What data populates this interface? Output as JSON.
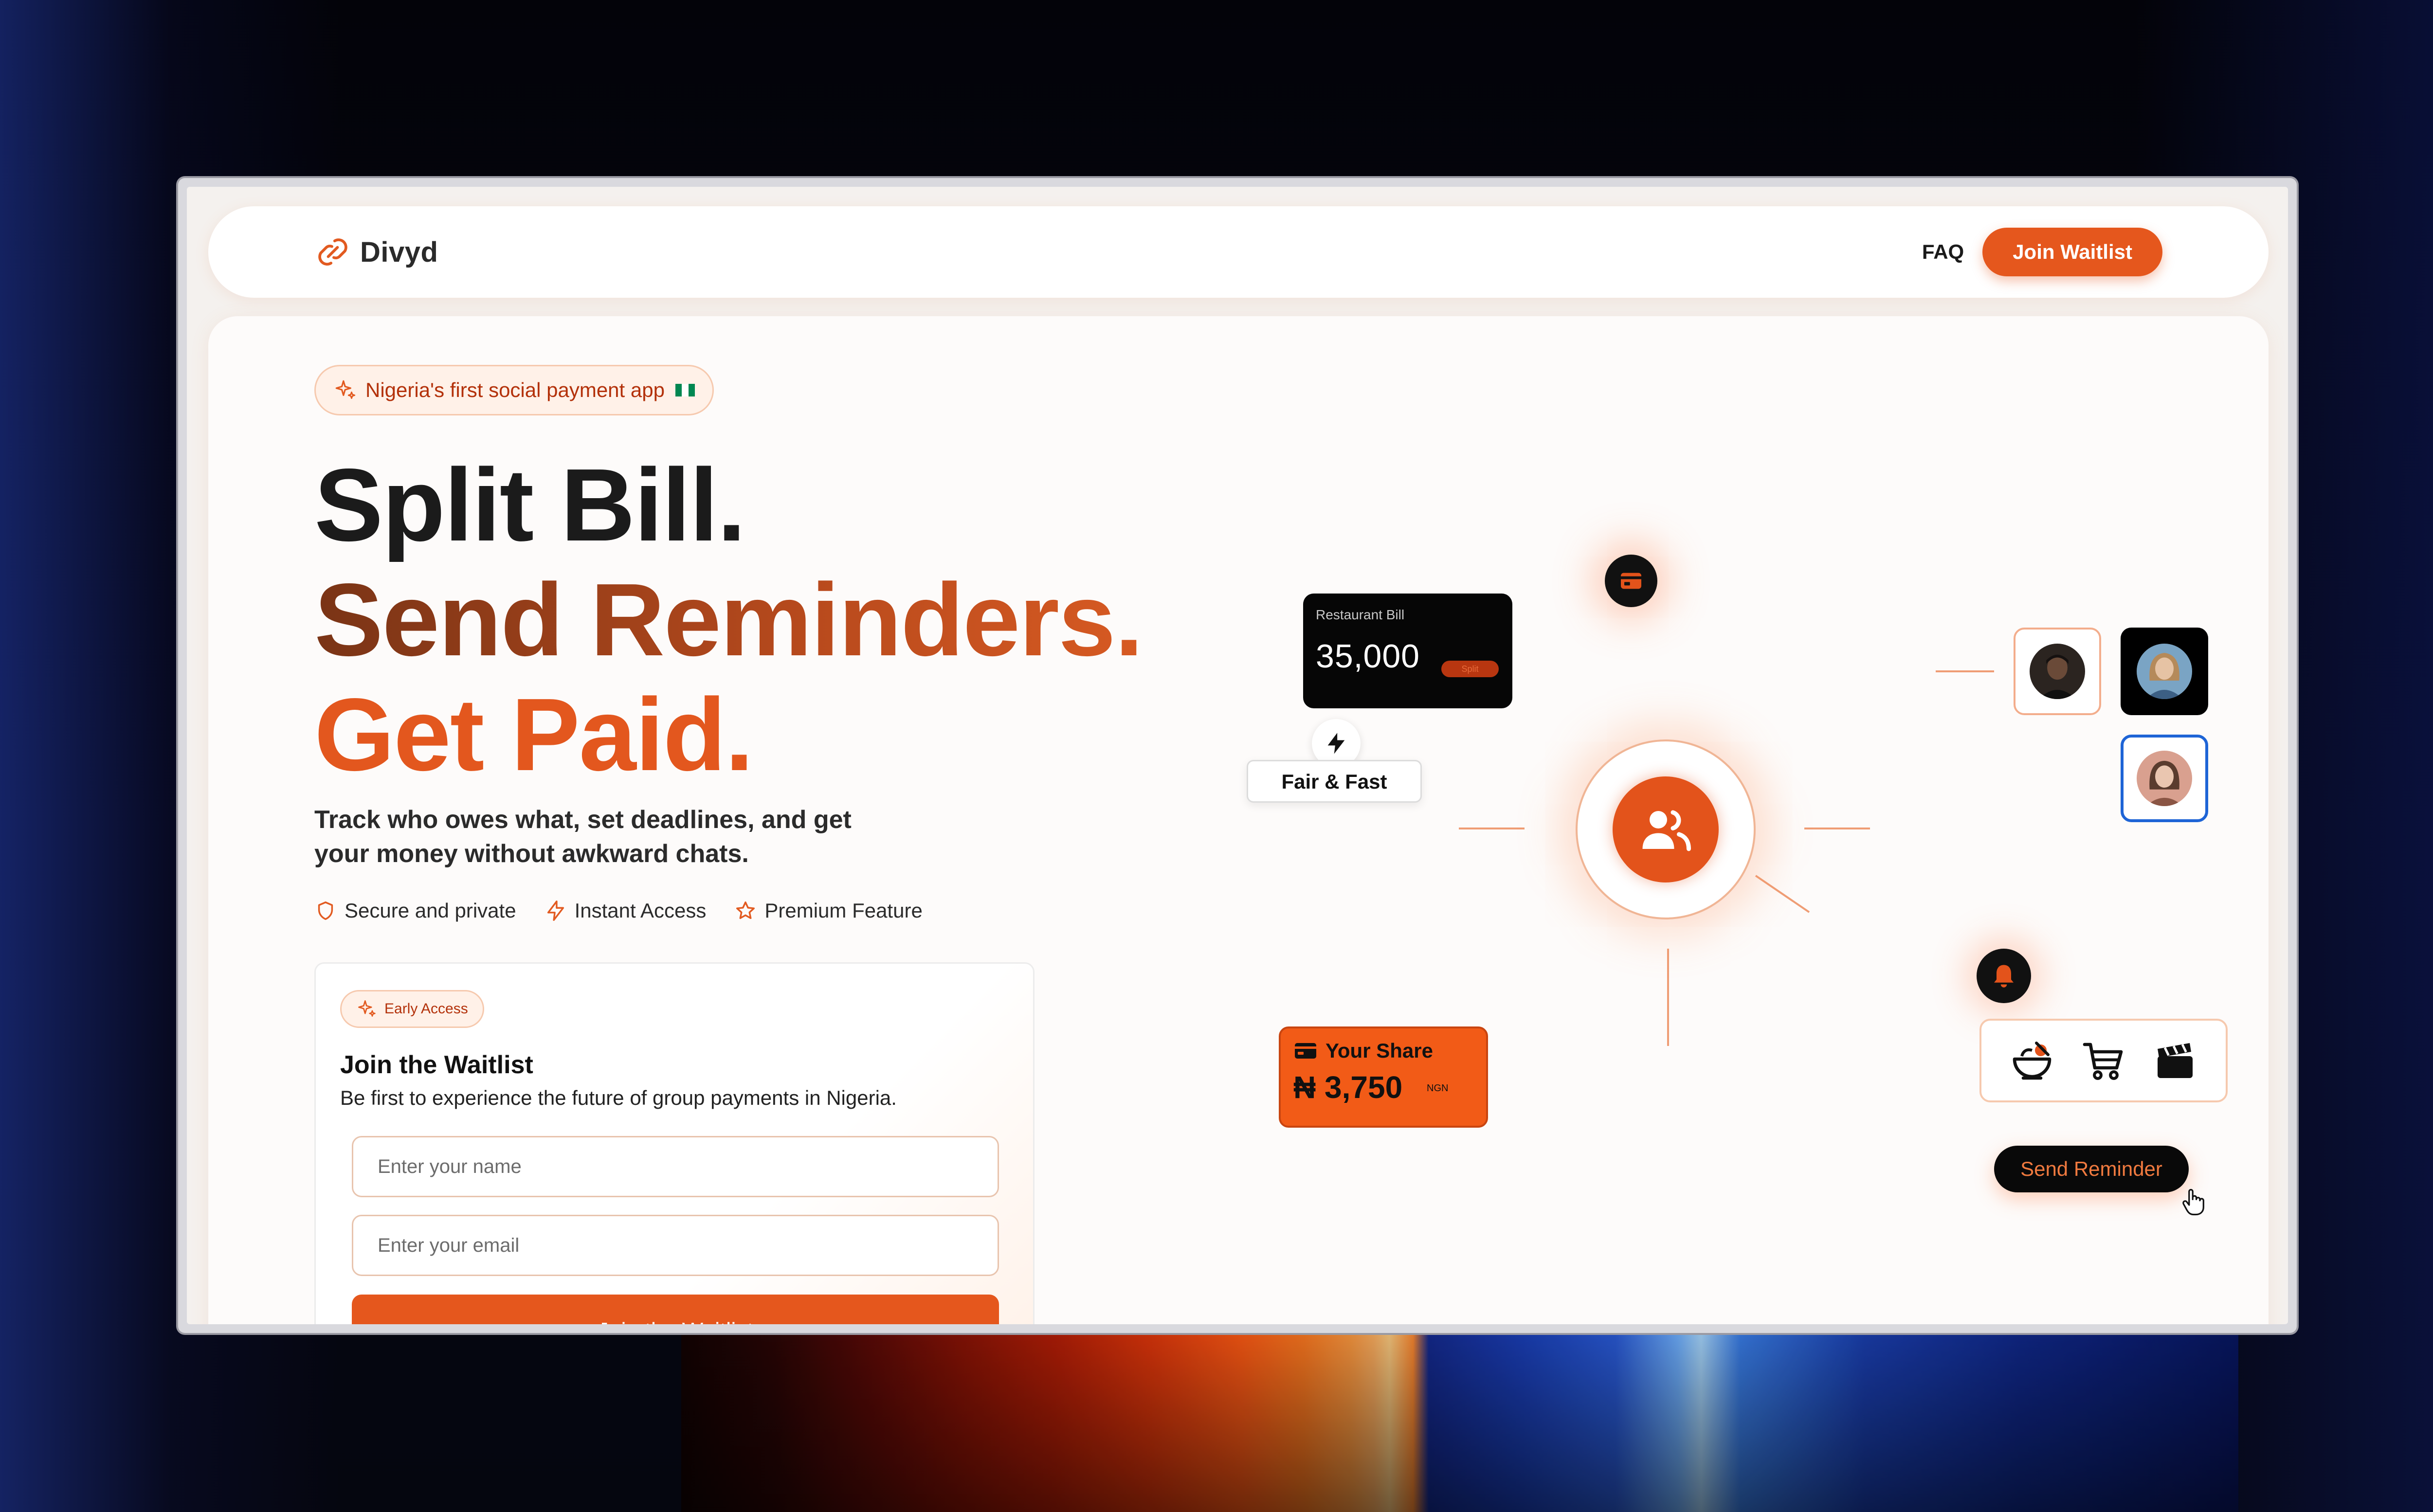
{
  "nav": {
    "logo_text": "Divyd",
    "faq_label": "FAQ",
    "join_label": "Join Waitlist"
  },
  "hero": {
    "badge": "Nigeria's first social payment app",
    "line1": "Split Bill.",
    "line2": "Send Reminders.",
    "line3": "Get Paid.",
    "subhead": "Track who owes what, set deadlines, and get your money without awkward chats.",
    "features": [
      {
        "icon": "shield-icon",
        "label": "Secure and private"
      },
      {
        "icon": "lightning-icon",
        "label": "Instant Access"
      },
      {
        "icon": "star-icon",
        "label": "Premium Feature"
      }
    ]
  },
  "waitlist": {
    "badge": "Early Access",
    "title": "Join the Waitlist",
    "description": "Be first to experience the future of group payments in Nigeria.",
    "name_placeholder": "Enter your name",
    "email_placeholder": "Enter your email",
    "submit_label": "Join the Waitlist"
  },
  "illustration": {
    "bill_label": "Restaurant Bill",
    "bill_amount": "35,000",
    "bill_tag": "Split",
    "fair_label": "Fair & Fast",
    "share_title": "Your Share",
    "share_amount": "₦ 3,750",
    "share_currency": "NGN",
    "reminder_button": "Send Reminder",
    "categories": [
      "food-bowl-icon",
      "shopping-cart-icon",
      "clapperboard-icon"
    ]
  },
  "colors": {
    "accent": "#e5571d",
    "brown_gradient": "#7a3416",
    "dark": "#1b1b1b",
    "badge_bg": "#fff1e8",
    "flag_green": "#008751"
  }
}
